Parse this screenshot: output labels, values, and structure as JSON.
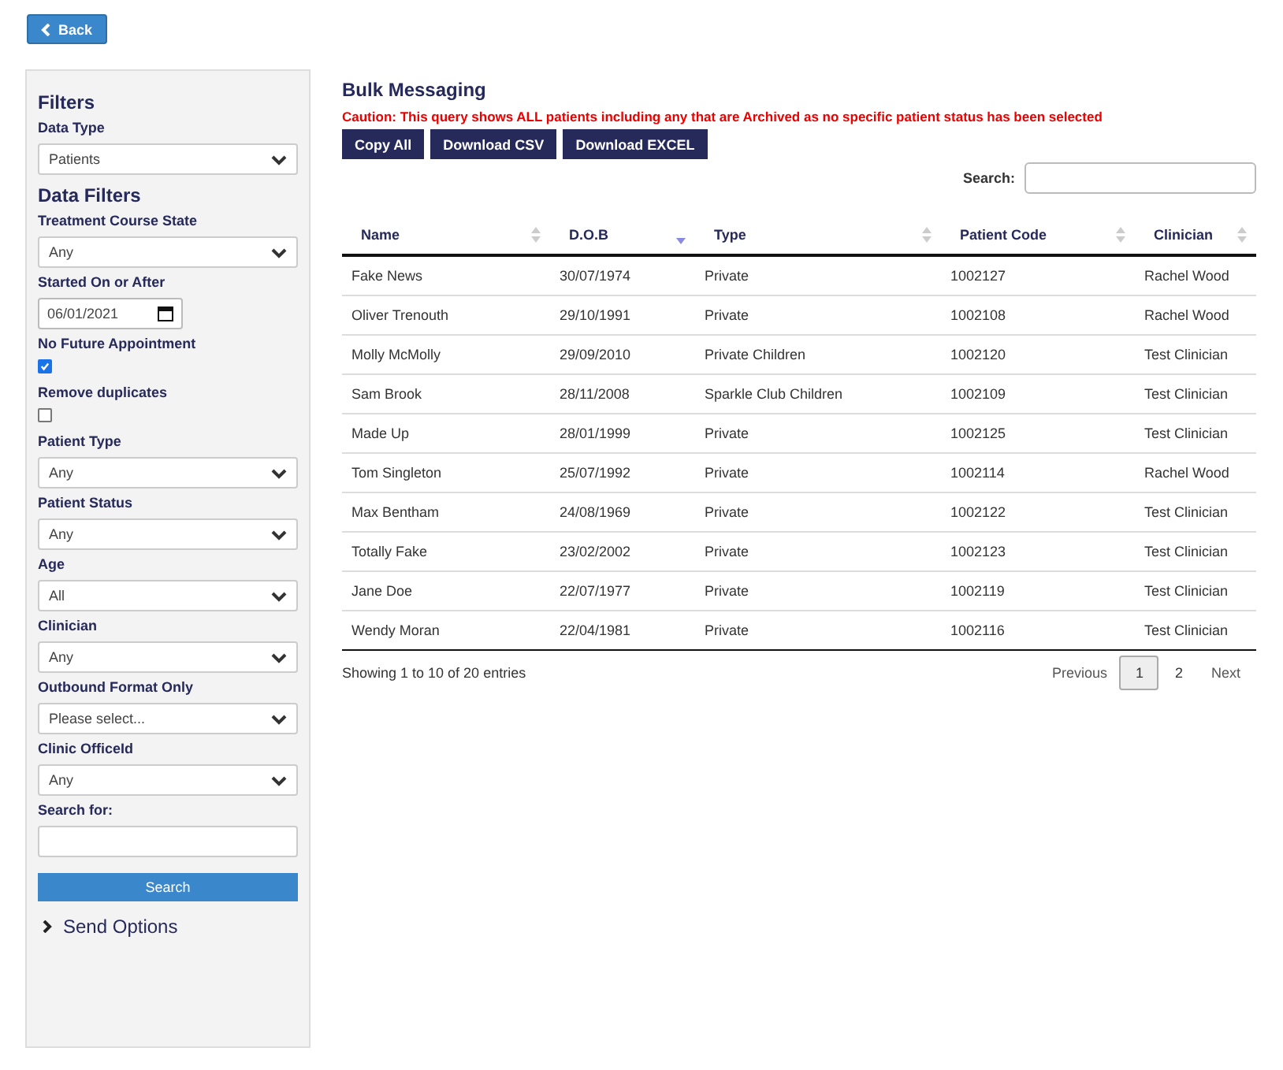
{
  "back_button": "Back",
  "filters": {
    "title": "Filters",
    "sections": [
      {
        "fields": [
          {
            "kind": "select",
            "label": "Data Type",
            "value": "Patients"
          }
        ]
      },
      {
        "heading": "Data Filters",
        "fields": [
          {
            "kind": "select",
            "label": "Treatment Course State",
            "value": "Any"
          },
          {
            "kind": "date",
            "label": "Started On or After",
            "value": "06/01/2021"
          },
          {
            "kind": "checkbox",
            "label": "No Future Appointment",
            "checked": true
          },
          {
            "kind": "checkbox",
            "label": "Remove duplicates",
            "checked": false
          },
          {
            "kind": "select",
            "label": "Patient Type",
            "value": "Any"
          },
          {
            "kind": "select",
            "label": "Patient Status",
            "value": "Any"
          },
          {
            "kind": "select",
            "label": "Age",
            "value": "All"
          },
          {
            "kind": "select",
            "label": "Clinician",
            "value": "Any"
          },
          {
            "kind": "select",
            "label": "Outbound Format Only",
            "value": "Please select..."
          },
          {
            "kind": "select",
            "label": "Clinic OfficeId",
            "value": "Any"
          },
          {
            "kind": "text",
            "label": "Search for:"
          }
        ]
      }
    ],
    "search_button": "Search",
    "send_options": {
      "label": "Send Options",
      "expanded": false
    }
  },
  "main": {
    "title": "Bulk Messaging",
    "caution": "Caution: This query shows ALL patients including any that are Archived as no specific patient status has been selected",
    "buttons": [
      "Copy All",
      "Download CSV",
      "Download EXCEL"
    ],
    "search_label": "Search:",
    "table": {
      "columns": [
        {
          "label": "Name",
          "sorted": false
        },
        {
          "label": "D.O.B",
          "sorted": true
        },
        {
          "label": "Type",
          "sorted": false
        },
        {
          "label": "Patient Code",
          "sorted": false
        },
        {
          "label": "Clinician",
          "sorted": false
        }
      ],
      "rows": [
        [
          "Fake News",
          "30/07/1974",
          "Private",
          "1002127",
          "Rachel Wood"
        ],
        [
          "Oliver Trenouth",
          "29/10/1991",
          "Private",
          "1002108",
          "Rachel Wood"
        ],
        [
          "Molly McMolly",
          "29/09/2010",
          "Private Children",
          "1002120",
          "Test Clinician"
        ],
        [
          "Sam Brook",
          "28/11/2008",
          "Sparkle Club Children",
          "1002109",
          "Test Clinician"
        ],
        [
          "Made Up",
          "28/01/1999",
          "Private",
          "1002125",
          "Test Clinician"
        ],
        [
          "Tom Singleton",
          "25/07/1992",
          "Private",
          "1002114",
          "Rachel Wood"
        ],
        [
          "Max Bentham",
          "24/08/1969",
          "Private",
          "1002122",
          "Test Clinician"
        ],
        [
          "Totally Fake",
          "23/02/2002",
          "Private",
          "1002123",
          "Test Clinician"
        ],
        [
          "Jane Doe",
          "22/07/1977",
          "Private",
          "1002119",
          "Test Clinician"
        ],
        [
          "Wendy Moran",
          "22/04/1981",
          "Private",
          "1002116",
          "Test Clinician"
        ]
      ]
    },
    "info": "Showing 1 to 10 of 20 entries",
    "pagination": {
      "previous": "Previous",
      "pages": [
        {
          "label": "1",
          "selected": true
        },
        {
          "label": "2",
          "selected": false
        }
      ],
      "next": "Next"
    }
  }
}
